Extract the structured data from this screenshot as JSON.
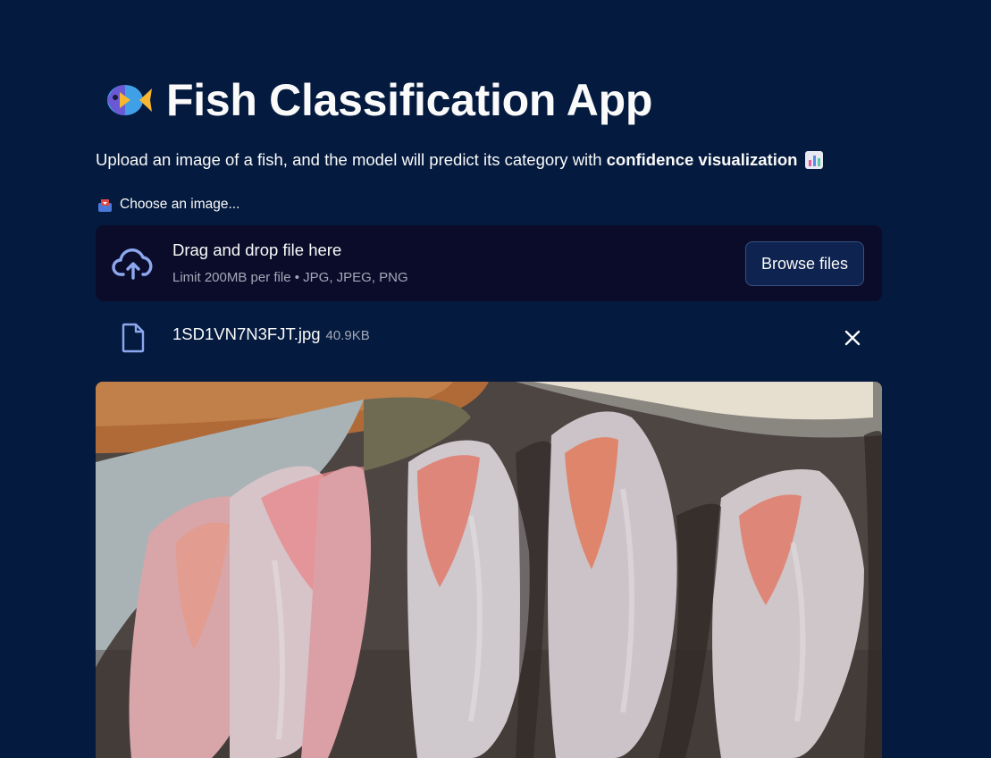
{
  "app": {
    "title": "Fish Classification App",
    "title_icon": "tropical-fish-emoji",
    "subtitle_prefix": "Upload an image of a fish, and the model will predict its category with",
    "subtitle_bold": "confidence visualization",
    "subtitle_icon": "bar-chart-emoji"
  },
  "uploader": {
    "label": "Choose an image...",
    "label_icon": "inbox-tray-emoji",
    "dropzone_title": "Drag and drop file here",
    "dropzone_limit": "Limit 200MB per file • JPG, JPEG, PNG",
    "browse_label": "Browse files",
    "dropzone_icon": "cloud-upload-icon"
  },
  "uploaded_file": {
    "name": "1SD1VN7N3FJT.jpg",
    "size": "40.9KB",
    "icon": "file-icon",
    "remove_icon": "close-icon"
  },
  "preview": {
    "image": "photo of pink fish lying in a row at a market"
  },
  "colors": {
    "background": "#041a3e",
    "dropzone": "#0b0c2a",
    "accent": "#8ea8f0"
  }
}
